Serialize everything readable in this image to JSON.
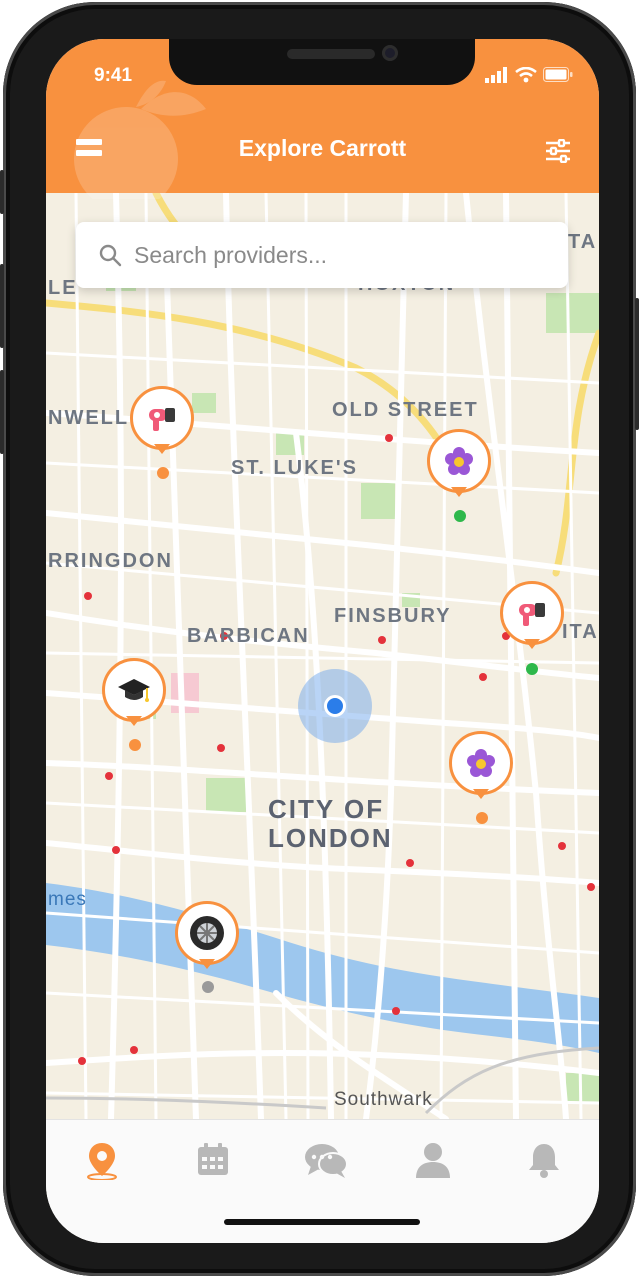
{
  "status": {
    "time": "9:41"
  },
  "header": {
    "title": "Explore Carrott",
    "background": "#f8913f"
  },
  "search": {
    "placeholder": "Search providers..."
  },
  "map": {
    "labels": [
      {
        "id": "hoxton",
        "text": "HOXTON"
      },
      {
        "id": "old-street",
        "text": "OLD STREET"
      },
      {
        "id": "st-lukes",
        "text": "ST. LUKE'S"
      },
      {
        "id": "clerkenwell",
        "text": "NWELL"
      },
      {
        "id": "farringdon",
        "text": "RRINGDON"
      },
      {
        "id": "finsbury",
        "text": "FINSBURY"
      },
      {
        "id": "barbican",
        "text": "BARBICAN"
      },
      {
        "id": "city-of-london-1",
        "text": "CITY OF"
      },
      {
        "id": "city-of-london-2",
        "text": "LONDON"
      },
      {
        "id": "southwark",
        "text": "Southwark"
      },
      {
        "id": "thames",
        "text": "mes"
      },
      {
        "id": "spitalfields",
        "text": "ITA"
      },
      {
        "id": "top-right",
        "text": "TA"
      },
      {
        "id": "left-edge",
        "text": "LE"
      }
    ]
  },
  "pins": [
    {
      "id": "hair-dryer-1",
      "icon": "hair-dryer-icon",
      "dot_color": "#f8913f"
    },
    {
      "id": "flower-1",
      "icon": "flower-icon",
      "dot_color": "#2eb84b"
    },
    {
      "id": "hair-dryer-2",
      "icon": "hair-dryer-icon",
      "dot_color": "#2eb84b"
    },
    {
      "id": "graduation-cap",
      "icon": "graduation-cap-icon",
      "dot_color": "#f8913f"
    },
    {
      "id": "flower-2",
      "icon": "flower-icon",
      "dot_color": "#f8913f"
    },
    {
      "id": "tire",
      "icon": "tire-icon",
      "dot_color": "#9a9a9a"
    }
  ],
  "tabs": [
    {
      "id": "explore",
      "icon": "location-pin-icon",
      "active": true,
      "color": "#f8913f"
    },
    {
      "id": "calendar",
      "icon": "calendar-icon",
      "active": false,
      "color": "#b8b8b8"
    },
    {
      "id": "messages",
      "icon": "chat-icon",
      "active": false,
      "color": "#b8b8b8"
    },
    {
      "id": "profile",
      "icon": "user-icon",
      "active": false,
      "color": "#b8b8b8"
    },
    {
      "id": "notifications",
      "icon": "bell-icon",
      "active": false,
      "color": "#b8b8b8"
    }
  ],
  "colors": {
    "accent": "#f8913f",
    "user_location": "#2b7de9"
  }
}
